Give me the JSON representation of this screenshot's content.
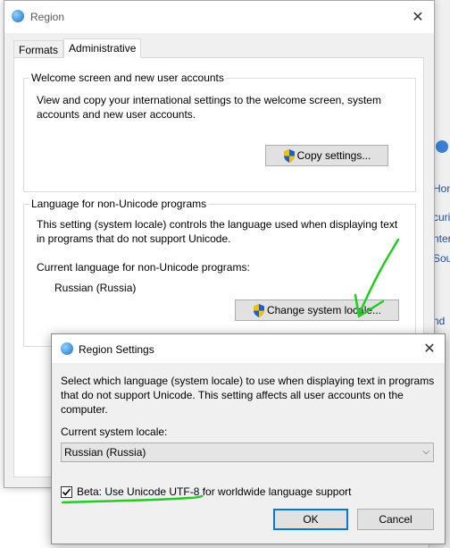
{
  "background_window": {
    "fragments": [
      "Hon",
      "curi",
      "nter",
      "Sou",
      "nd"
    ]
  },
  "window": {
    "title": "Region",
    "close_glyph": "✕",
    "tabs": [
      {
        "label": "Formats",
        "active": false
      },
      {
        "label": "Administrative",
        "active": true
      }
    ]
  },
  "welcome_group": {
    "legend": "Welcome screen and new user accounts",
    "description": "View and copy your international settings to the welcome screen, system accounts and new user accounts.",
    "copy_button_label": "Copy settings..."
  },
  "locale_group": {
    "legend": "Language for non-Unicode programs",
    "description": "This setting (system locale) controls the language used when displaying text in programs that do not support Unicode.",
    "current_label": "Current language for non-Unicode programs:",
    "current_value": "Russian (Russia)",
    "change_button_label": "Change system locale..."
  },
  "dialog": {
    "title": "Region Settings",
    "close_glyph": "✕",
    "description": "Select which language (system locale) to use when displaying text in programs that do not support Unicode. This setting affects all user accounts on the computer.",
    "current_locale_label": "Current system locale:",
    "current_locale_value": "Russian (Russia)",
    "beta_checkbox_label": "Beta: Use Unicode UTF-8 for worldwide language support",
    "beta_checked": true,
    "ok_label": "OK",
    "cancel_label": "Cancel"
  },
  "colors": {
    "annotation_green": "#22cc22",
    "ok_border": "#0078d7",
    "shield_blue": "#1f5fbf",
    "shield_yellow": "#f2c200"
  }
}
